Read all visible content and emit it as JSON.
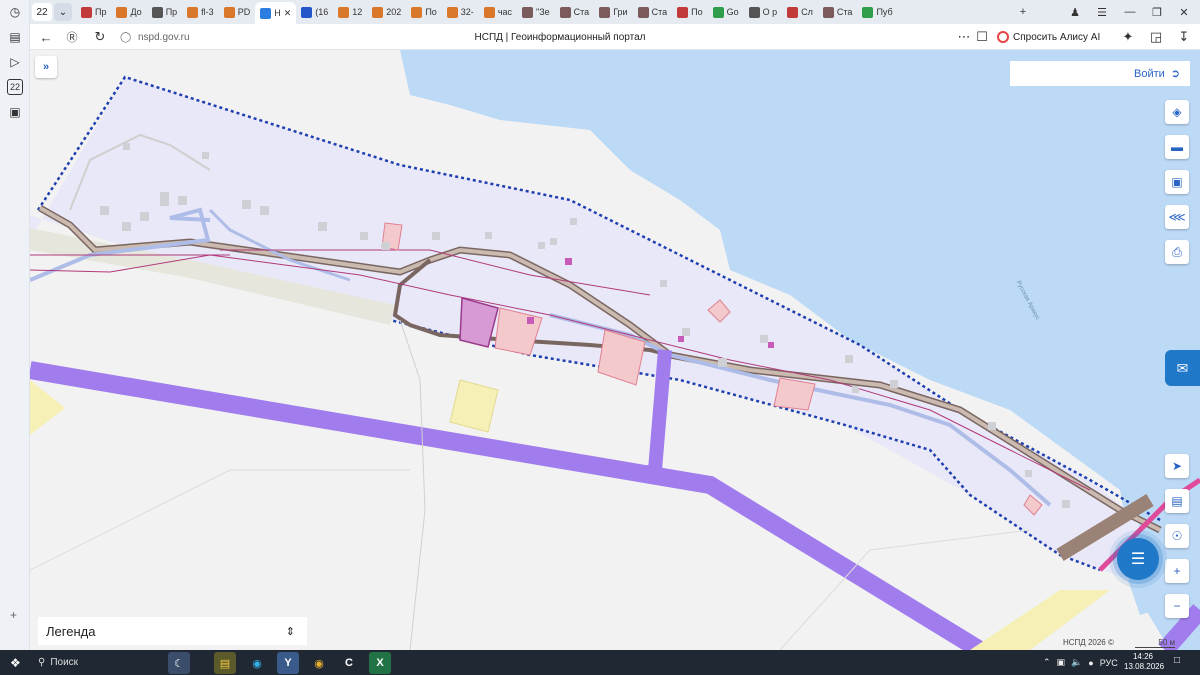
{
  "browser": {
    "tab_count": "22",
    "tabs": [
      {
        "label": "Пр",
        "color": "#c23a3a"
      },
      {
        "label": "До",
        "color": "#d9782b"
      },
      {
        "label": "Пр",
        "color": "#555"
      },
      {
        "label": "fl-3",
        "color": "#d9782b"
      },
      {
        "label": "PD",
        "color": "#d9782b"
      },
      {
        "label": "Н",
        "color": "#2b7de0"
      },
      {
        "label": "(16",
        "color": "#2256c9"
      },
      {
        "label": "12",
        "color": "#d9782b"
      },
      {
        "label": "202",
        "color": "#d9782b"
      },
      {
        "label": "По",
        "color": "#d9782b"
      },
      {
        "label": "32-",
        "color": "#d9782b"
      },
      {
        "label": "час",
        "color": "#d9782b"
      },
      {
        "label": "\"Зе",
        "color": "#7a5a5a"
      },
      {
        "label": "Ста",
        "color": "#7a5a5a"
      },
      {
        "label": "Гри",
        "color": "#7a5a5a"
      },
      {
        "label": "Ста",
        "color": "#7a5a5a"
      },
      {
        "label": "По",
        "color": "#c23a3a"
      },
      {
        "label": "Go",
        "color": "#2e9e4a"
      },
      {
        "label": "О р",
        "color": "#555"
      },
      {
        "label": "Сл",
        "color": "#c23a3a"
      },
      {
        "label": "Ста",
        "color": "#7a5a5a"
      },
      {
        "label": "Пуб",
        "color": "#2e9e4a"
      }
    ],
    "url_host": "nspd.gov.ru",
    "page_title": "НСПД | Геоинформационный портал",
    "alice_label": "Спросить Алису AI"
  },
  "map": {
    "login_label": "Войти",
    "river_label": "Русская Аракус",
    "legend_label": "Легенда",
    "copyright": "НСПД 2026 ©",
    "scale_label": "50 м"
  },
  "taskbar": {
    "search_label": "Поиск",
    "lang": "РУС",
    "time": "14:26",
    "date": "13.08.2026"
  }
}
